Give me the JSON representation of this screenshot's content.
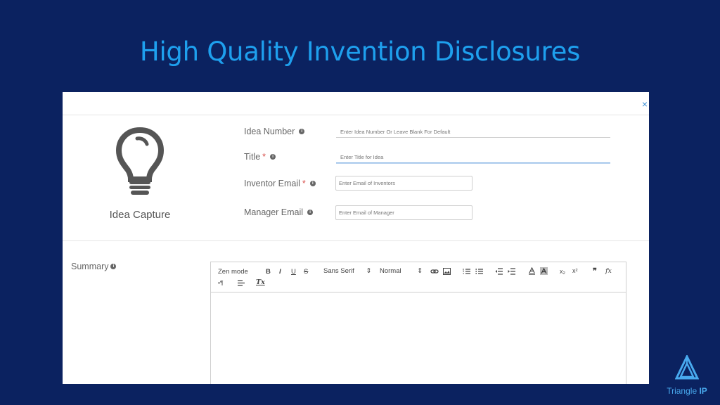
{
  "slide": {
    "title": "High Quality Invention Disclosures"
  },
  "panel": {
    "close_icon": "×",
    "idea_caption": "Idea Capture",
    "fields": {
      "idea_number": {
        "label": "Idea Number",
        "required": "",
        "placeholder": "Enter Idea Number Or Leave Blank For Default"
      },
      "title": {
        "label": "Title",
        "required": "*",
        "placeholder": "Enter Title for Idea"
      },
      "inventor_email": {
        "label": "Inventor Email",
        "required": "*",
        "placeholder": "Enter Email of Inventors"
      },
      "manager_email": {
        "label": "Manager Email",
        "required": "",
        "placeholder": "Enter Email of Manager"
      }
    },
    "info_glyph": "i",
    "summary": {
      "label": "Summary",
      "toolbar": {
        "zen_mode": "Zen mode",
        "bold": "B",
        "italic": "I",
        "underline": "U",
        "strike": "S",
        "font_family": "Sans Serif",
        "font_size": "Normal",
        "dropdown_glyph": "⇕",
        "subscript": "x₂",
        "superscript": "x²",
        "blockquote": "❞",
        "formula": "fx",
        "rtl": "•¶",
        "clean": "Tx"
      }
    }
  },
  "logo": {
    "text_regular": "Triangle ",
    "text_bold": "IP"
  },
  "colors": {
    "background": "#0b2260",
    "title": "#1ea0ee",
    "accent": "#3b8fd6",
    "logo": "#48a9ee"
  }
}
